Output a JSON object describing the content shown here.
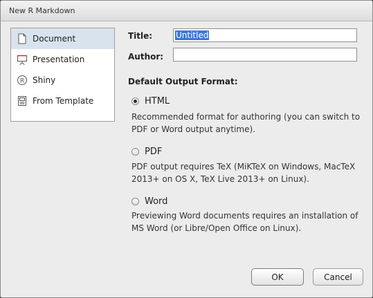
{
  "window": {
    "title": "New R Markdown"
  },
  "sidebar": {
    "items": [
      {
        "label": "Document",
        "icon": "document-icon",
        "selected": true
      },
      {
        "label": "Presentation",
        "icon": "presentation-icon",
        "selected": false
      },
      {
        "label": "Shiny",
        "icon": "shiny-r-icon",
        "selected": false
      },
      {
        "label": "From Template",
        "icon": "template-icon",
        "selected": false
      }
    ]
  },
  "form": {
    "title_label": "Title:",
    "title_value": "Untitled",
    "author_label": "Author:",
    "author_value": ""
  },
  "output": {
    "heading": "Default Output Format:",
    "options": [
      {
        "label": "HTML",
        "checked": true,
        "desc_line1": "Recommended format for authoring (you can switch to",
        "desc_line2": "PDF or Word output anytime)."
      },
      {
        "label": "PDF",
        "checked": false,
        "desc_line1": "PDF output requires TeX (MiKTeX on Windows, MacTeX",
        "desc_line2": "2013+ on OS X, TeX Live 2013+ on Linux)."
      },
      {
        "label": "Word",
        "checked": false,
        "desc_line1": "Previewing Word documents requires an installation of",
        "desc_line2": "MS Word (or Libre/Open Office on Linux)."
      }
    ]
  },
  "buttons": {
    "ok": "OK",
    "cancel": "Cancel"
  },
  "colors": {
    "selection": "#d9e3ee",
    "text_highlight": "#3a79d6"
  }
}
